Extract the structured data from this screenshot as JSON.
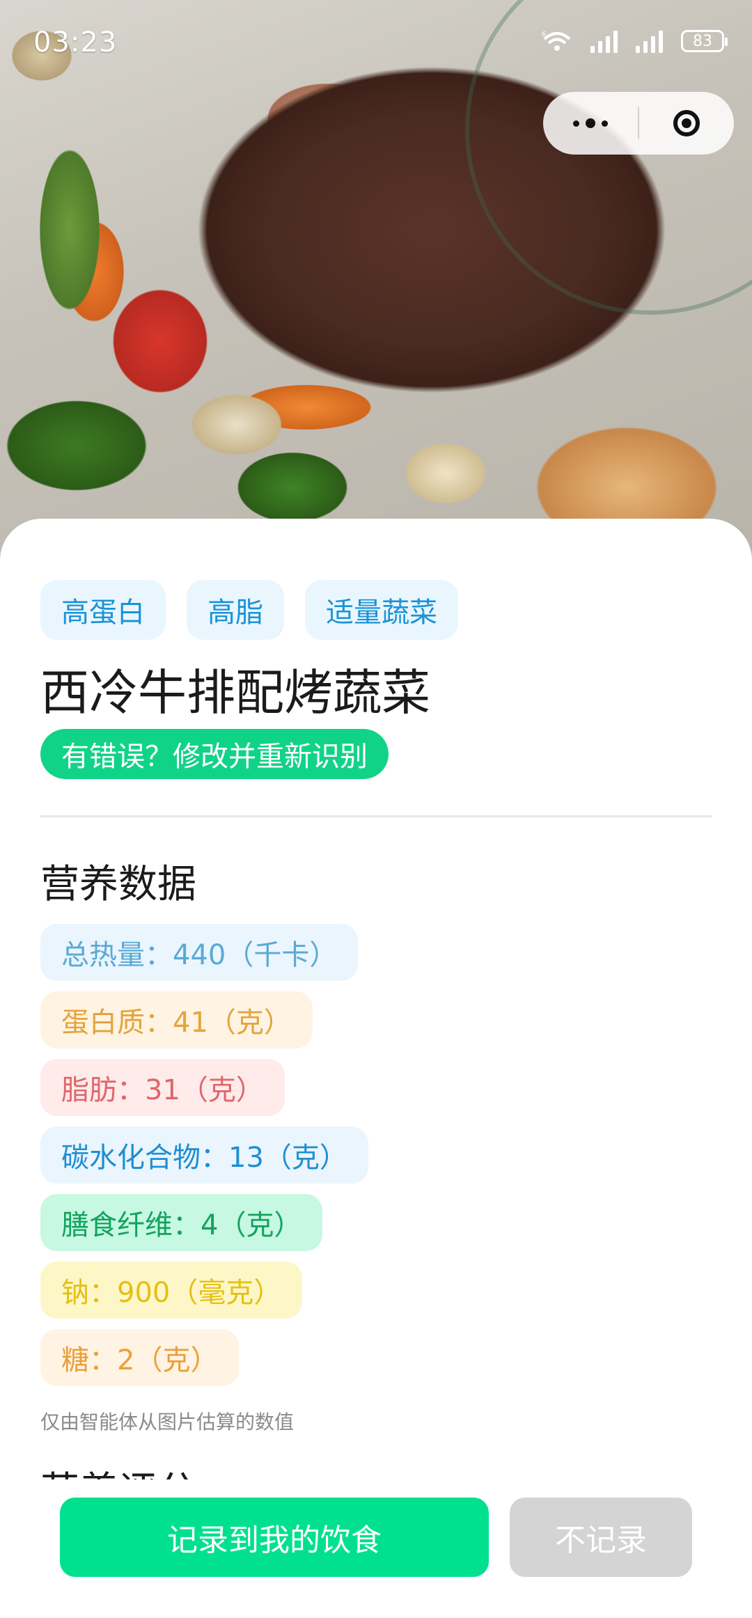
{
  "status_bar": {
    "time": "03:23",
    "wifi_badge": "6",
    "battery": "83"
  },
  "capsule": {
    "more_icon": "more-dots-icon",
    "close_icon": "target-close-icon"
  },
  "food": {
    "tags": [
      "高蛋白",
      "高脂",
      "适量蔬菜"
    ],
    "name": "西冷牛排配烤蔬菜",
    "fix_button": "有错误？修改并重新识别"
  },
  "nutrition": {
    "section_title": "营养数据",
    "items": [
      {
        "text": "总热量：440（千卡）",
        "bg": "#eaf5fd",
        "color": "#5aa9d6"
      },
      {
        "text": "蛋白质：41（克）",
        "bg": "#fff3e3",
        "color": "#e4a43c"
      },
      {
        "text": "脂肪：31（克）",
        "bg": "#feebea",
        "color": "#e0666a"
      },
      {
        "text": "碳水化合物：13（克）",
        "bg": "#eaf5fd",
        "color": "#1f8ed2"
      },
      {
        "text": "膳食纤维：4（克）",
        "bg": "#c7f8e2",
        "color": "#12a35d"
      },
      {
        "text": "钠：900（毫克）",
        "bg": "#fdf7c8",
        "color": "#e6bf13"
      },
      {
        "text": "糖：2（克）",
        "bg": "#fff3e3",
        "color": "#e9a03a"
      }
    ],
    "note": "仅由智能体从图片估算的数值"
  },
  "next_section_title": "营养评分",
  "actions": {
    "record": "记录到我的饮食",
    "skip": "不记录"
  },
  "colors": {
    "accent": "#00e08f",
    "tag_text": "#1a93d8"
  }
}
